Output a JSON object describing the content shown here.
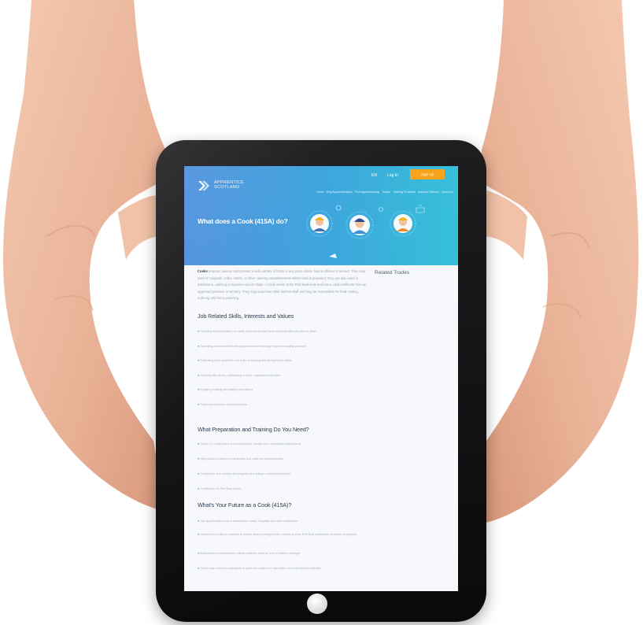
{
  "screen": {
    "header": {
      "logo_text": "Apprentice\nScotland",
      "lang": "EN",
      "login": "Log In",
      "signup": "Sign Up",
      "nav": [
        "Home",
        "Why Apprenticeships",
        "Find Apprenticeship",
        "Trades",
        "Training Providers",
        "Industry Partners",
        "About Us"
      ],
      "hero_title": "What does a Cook (415A) do?"
    },
    "intro": {
      "lead": "Cooks",
      "text": "prepare, season and present a wide variety of foods in any place where food is offered or served. They may work in hospitals, cafes, hotels, or other catering establishments where food is prepared; they can also work in institutions, catering companies and on ships. A Cook works at the Red Seal level and has a valid certificate from an approved province or territory. They may supervise other kitchen staff and may be responsible for food costing, ordering and menu planning."
    },
    "related_title": "Related Trades",
    "sections": [
      {
        "title": "Job Related Skills, Interests and Values",
        "items": [
          "Planning and preparation of meals, menu items and menu elements with attention to detail",
          "Operating commercial kitchen equipment and following recipes for quality products",
          "Estimating food quantities and costs, preparing and storing foods safely",
          "Working with others, maintaining a clean, organized work area",
          "Enjoying creating and tasting new dishes",
          "Following directions and instructions"
        ]
      },
      {
        "title": "What Preparation and Training Do You Need?",
        "items": [
          "Grade 12 or equivalent is recommended, though not a mandatory requirement",
          "High school courses in food studies and math are recommended",
          "Completion of a culinary arts program at a college or technical institute",
          "Certification for Red Seal trades"
        ]
      },
      {
        "title": "What's Your Future as a Cook (415A)?",
        "items": [
          "Job opportunities exist in restaurants, hotels, hospitals and other institutions",
          "Demand for cooks is expected to remain strong throughout the country and the Red Seal certification is widely recognized",
          "Advancement opportunities include positions such as chef or kitchen manager",
          "Cooks may choose to specialize in particular cuisines or open their own food service business"
        ]
      }
    ]
  }
}
